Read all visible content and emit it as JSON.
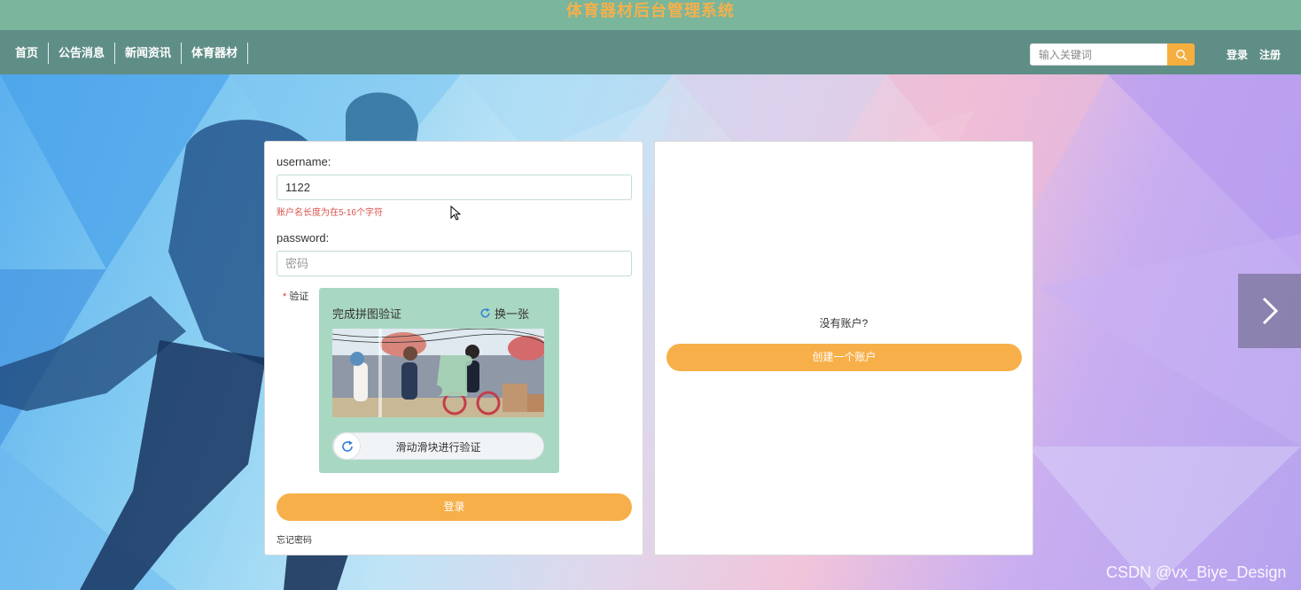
{
  "site": {
    "title": "体育器材后台管理系统"
  },
  "nav": {
    "items": [
      "首页",
      "公告消息",
      "新闻资讯",
      "体育器材"
    ]
  },
  "search": {
    "placeholder": "输入关键词",
    "icon": "search-icon"
  },
  "auth": {
    "login_label": "登录",
    "register_label": "注册"
  },
  "login_form": {
    "username_label": "username:",
    "username_value": "1122",
    "username_error": "账户名长度为在5-16个字符",
    "password_label": "password:",
    "password_placeholder": "密码",
    "verify_label": "验证",
    "captcha": {
      "title": "完成拼图验证",
      "refresh_label": "换一张",
      "slider_text": "滑动滑块进行验证"
    },
    "submit_label": "登录",
    "forgot_label": "忘记密码"
  },
  "register_panel": {
    "prompt": "没有账户?",
    "create_label": "创建一个账户"
  },
  "watermark": "CSDN @vx_Biye_Design",
  "colors": {
    "topbar": "#79b69b",
    "navbar": "#5f8e86",
    "accent": "#f7af4a",
    "title": "#f5b04c",
    "error": "#d9534f"
  }
}
